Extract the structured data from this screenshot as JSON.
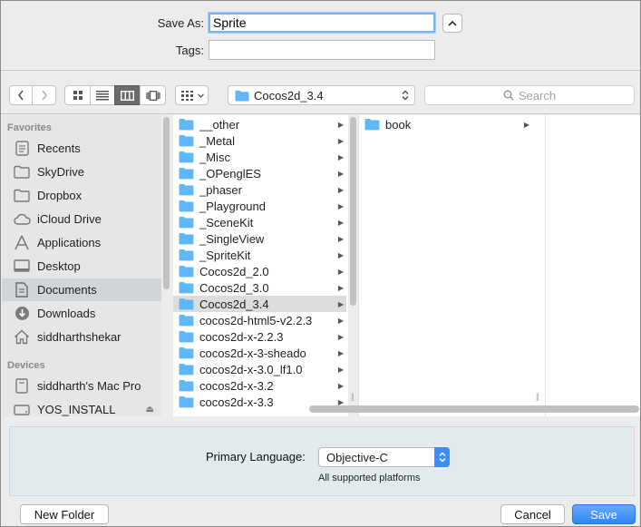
{
  "form": {
    "save_as_label": "Save As:",
    "save_as_value": "Sprite",
    "tags_label": "Tags:",
    "tags_value": ""
  },
  "toolbar": {
    "location": "Cocos2d_3.4",
    "search_placeholder": "Search",
    "selected_view": "columns"
  },
  "sidebar": {
    "favorites_heading": "Favorites",
    "favorites": [
      {
        "label": "Recents",
        "icon": "clock-icon"
      },
      {
        "label": "SkyDrive",
        "icon": "folder-icon"
      },
      {
        "label": "Dropbox",
        "icon": "folder-icon"
      },
      {
        "label": "iCloud Drive",
        "icon": "cloud-icon"
      },
      {
        "label": "Applications",
        "icon": "applications-icon"
      },
      {
        "label": "Desktop",
        "icon": "desktop-icon"
      },
      {
        "label": "Documents",
        "icon": "documents-icon"
      },
      {
        "label": "Downloads",
        "icon": "downloads-icon"
      },
      {
        "label": "siddharthshekar",
        "icon": "home-icon"
      }
    ],
    "selected_favorite": "Documents",
    "devices_heading": "Devices",
    "devices": [
      {
        "label": "siddharth's Mac Pro",
        "icon": "computer-icon"
      },
      {
        "label": "YOS_INSTALL",
        "icon": "disk-icon"
      }
    ]
  },
  "browser": {
    "column1": [
      "__other",
      "_Metal",
      "_Misc",
      "_OPenglES",
      "_phaser",
      "_Playground",
      "_SceneKit",
      "_SingleView",
      "_SpriteKit",
      "Cocos2d_2.0",
      "Cocos2d_3.0",
      "Cocos2d_3.4",
      "cocos2d-html5-v2.2.3",
      "cocos2d-x-2.2.3",
      "cocos2d-x-3-sheado",
      "cocos2d-x-3.0_lf1.0",
      "cocos2d-x-3.2",
      "cocos2d-x-3.3"
    ],
    "column1_selected": "Cocos2d_3.4",
    "column2": [
      "book"
    ]
  },
  "options": {
    "primary_language_label": "Primary Language:",
    "primary_language_value": "Objective-C",
    "platforms_hint": "All supported platforms"
  },
  "buttons": {
    "new_folder": "New Folder",
    "cancel": "Cancel",
    "save": "Save"
  },
  "colors": {
    "accent": "#3d8df6",
    "folder": "#5fb7f5",
    "selection": "#d1d5da"
  }
}
